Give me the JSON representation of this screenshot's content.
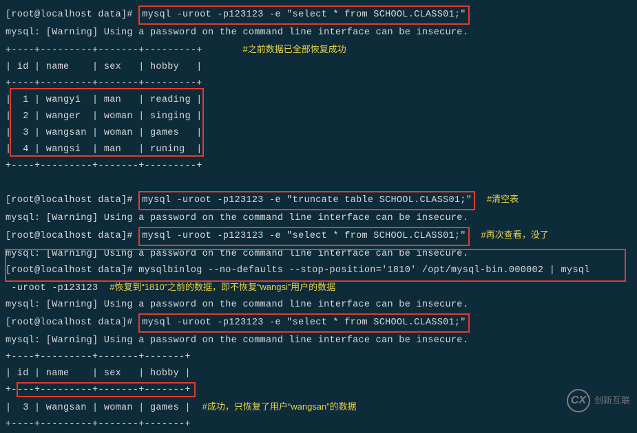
{
  "prompt": "[root@localhost data]# ",
  "cmds": {
    "select1": "mysql -uroot -p123123 -e \"select * from SCHOOL.CLASS01;\"",
    "truncate": "mysql -uroot -p123123 -e \"truncate table SCHOOL.CLASS01;\"",
    "select2": "mysql -uroot -p123123 -e \"select * from SCHOOL.CLASS01;\"",
    "binlog1": "mysqlbinlog --no-defaults --stop-position='1810' /opt/mysql-bin.000002 | mysql",
    "binlog2": " -uroot -p123123",
    "select3": "mysql -uroot -p123123 -e \"select * from SCHOOL.CLASS01;\""
  },
  "warn": "mysql: [Warning] Using a password on the command line interface can be insecure.",
  "table_full": {
    "border": "+----+---------+-------+---------+",
    "header": "| id | name    | sex   | hobby   |",
    "rows": [
      "|  1 | wangyi  | man   | reading |",
      "|  2 | wanger  | woman | singing |",
      "|  3 | wangsan | woman | games   |",
      "|  4 | wangsi  | man   | runing  |"
    ]
  },
  "table_one": {
    "border": "+----+---------+-------+-------+",
    "header": "| id | name    | sex   | hobby |",
    "row": "|  3 | wangsan | woman | games |"
  },
  "annotations": {
    "a1": "#之前数据已全部恢复成功",
    "a2": "#清空表",
    "a3": "#再次查看，没了",
    "a4": "#恢复到“1810”之前的数据，即不恢复“wangsi”用户的数据",
    "a5": "#成功，只恢复了用户“wangsan”的数据"
  },
  "watermark": "创新互联"
}
